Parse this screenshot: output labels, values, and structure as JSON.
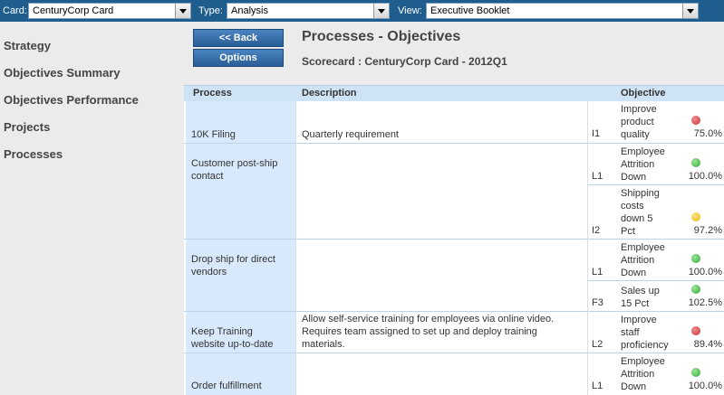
{
  "toolbar": {
    "card_label": "Card:",
    "card_value": "CenturyCorp Card",
    "type_label": "Type:",
    "type_value": "Analysis",
    "view_label": "View:",
    "view_value": "Executive Booklet"
  },
  "sidebar": {
    "items": [
      {
        "label": "Strategy"
      },
      {
        "label": "Objectives Summary"
      },
      {
        "label": "Objectives Performance"
      },
      {
        "label": "Projects"
      },
      {
        "label": "Processes"
      }
    ]
  },
  "buttons": {
    "back": "<< Back",
    "options": "Options"
  },
  "page": {
    "title": "Processes - Objectives",
    "subtitle": "Scorecard : CenturyCorp Card - 2012Q1"
  },
  "table": {
    "headers": {
      "process": "Process",
      "description": "Description",
      "objective": "Objective"
    },
    "rows": [
      {
        "process": "10K Filing",
        "description": "Quarterly requirement",
        "code": "I1",
        "objective": "Improve product quality",
        "status": "red",
        "percent": "75.0%"
      },
      {
        "process": "Customer post-ship contact",
        "description": "",
        "code": "L1",
        "objective": "Employee Attrition Down",
        "status": "green",
        "percent": "100.0%"
      },
      {
        "process": "",
        "description": "",
        "code": "I2",
        "objective": "Shipping costs down 5 Pct",
        "status": "yellow",
        "percent": "97.2%"
      },
      {
        "process": "Drop ship for direct vendors",
        "description": "",
        "code": "L1",
        "objective": "Employee Attrition Down",
        "status": "green",
        "percent": "100.0%"
      },
      {
        "process": "",
        "description": "",
        "code": "F3",
        "objective": "Sales up 15 Pct",
        "status": "green",
        "percent": "102.5%"
      },
      {
        "process": "Keep Training website up-to-date",
        "description": "Allow self-service training for employees via online video. Requires team assigned to set up and deploy training materials.",
        "code": "L2",
        "objective": "Improve staff proficiency",
        "status": "red",
        "percent": "89.4%"
      },
      {
        "process": "Order fulfillment",
        "description": "",
        "code": "L1",
        "objective": "Employee Attrition Down",
        "status": "green",
        "percent": "100.0%"
      }
    ]
  },
  "colors": {
    "toolbar": "#1f5d8e",
    "header_row": "#cfe3f6",
    "process_cell": "#d7e9fa",
    "status_red": "#c8323a",
    "status_green": "#3cb43c",
    "status_yellow": "#f2c21b"
  }
}
